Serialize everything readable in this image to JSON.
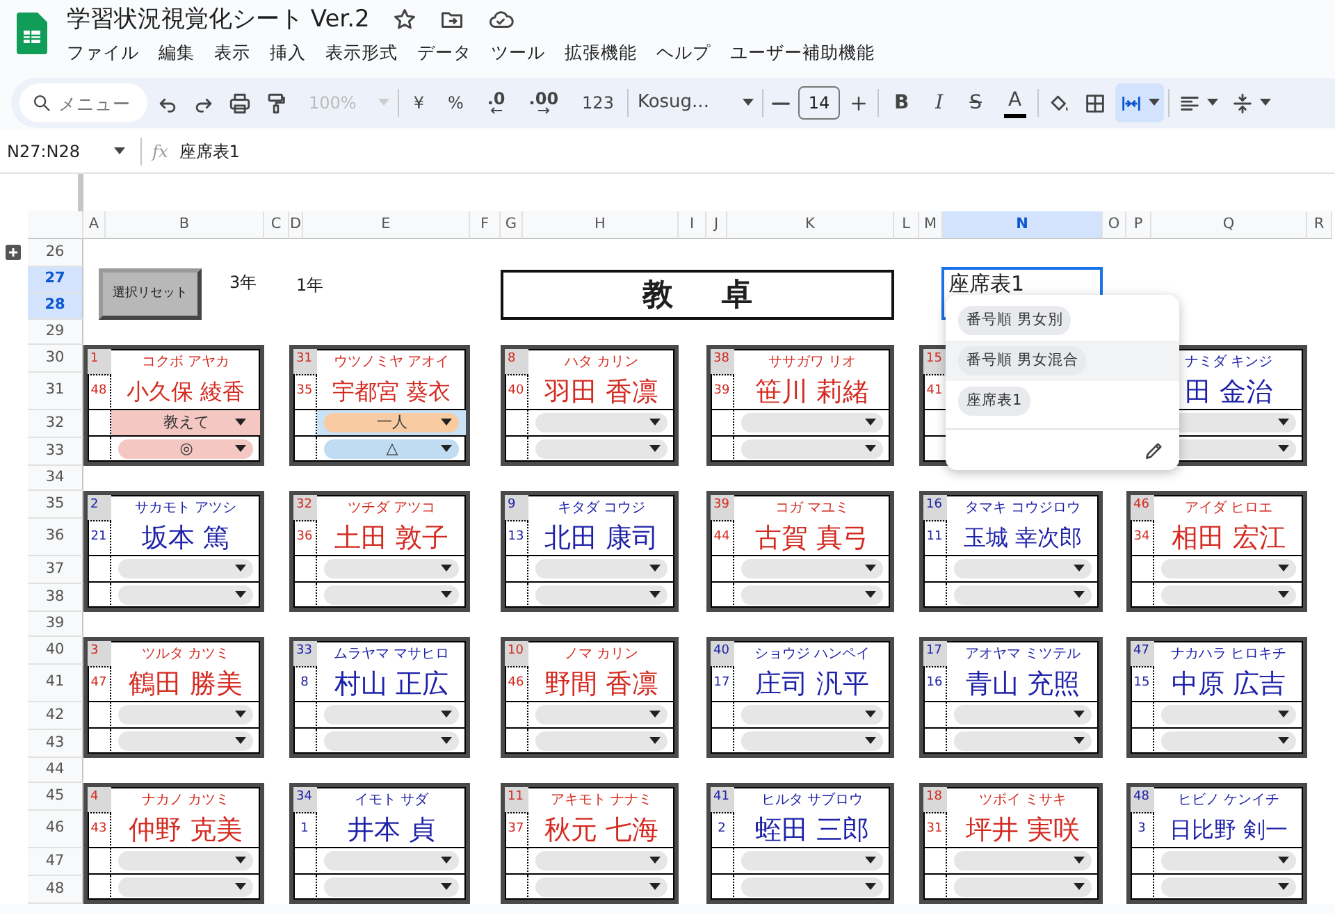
{
  "window": {
    "title": "学習状況視覚化シート Ver.2"
  },
  "menu": [
    "ファイル",
    "編集",
    "表示",
    "挿入",
    "表示形式",
    "データ",
    "ツール",
    "拡張機能",
    "ヘルプ",
    "ユーザー補助機能"
  ],
  "toolbar": {
    "search": {
      "placeholder": "メニュー"
    },
    "zoom": {
      "value": "100%",
      "disabled": true
    },
    "number_formats": [
      {
        "kind": "plain",
        "label": "¥"
      },
      {
        "kind": "plain",
        "label": "%"
      },
      {
        "kind": "decrease",
        "label": ".0"
      },
      {
        "kind": "increase",
        "label": ".00"
      },
      {
        "kind": "plain",
        "label": "123"
      }
    ],
    "font": "Kosug...",
    "font_size": "14",
    "text_styles": [
      {
        "kind": "bold",
        "label": "B"
      },
      {
        "kind": "italic",
        "label": "I"
      },
      {
        "kind": "strikethrough",
        "label": "S"
      },
      {
        "kind": "text_color",
        "label": "A"
      }
    ],
    "merge_selected": true
  },
  "formula_bar": {
    "range": "N27:N28",
    "label": "fx",
    "value": "座席表1"
  },
  "columns": [
    {
      "label": "A",
      "selected": false
    },
    {
      "label": "B",
      "selected": false
    },
    {
      "label": "C",
      "selected": false
    },
    {
      "label": "D",
      "selected": false
    },
    {
      "label": "E",
      "selected": false
    },
    {
      "label": "F",
      "selected": false
    },
    {
      "label": "G",
      "selected": false
    },
    {
      "label": "H",
      "selected": false
    },
    {
      "label": "I",
      "selected": false
    },
    {
      "label": "J",
      "selected": false
    },
    {
      "label": "K",
      "selected": false
    },
    {
      "label": "L",
      "selected": false
    },
    {
      "label": "M",
      "selected": false
    },
    {
      "label": "N",
      "selected": true
    },
    {
      "label": "O",
      "selected": false
    },
    {
      "label": "P",
      "selected": false
    },
    {
      "label": "Q",
      "selected": false
    },
    {
      "label": "R",
      "selected": false
    }
  ],
  "rows": [
    {
      "label": "26",
      "selected": false
    },
    {
      "label": "27",
      "selected": true
    },
    {
      "label": "28",
      "selected": true
    },
    {
      "label": "29",
      "selected": false
    },
    {
      "label": "30",
      "selected": false
    },
    {
      "label": "31",
      "selected": false
    },
    {
      "label": "32",
      "selected": false
    },
    {
      "label": "33",
      "selected": false
    },
    {
      "label": "34",
      "selected": false
    },
    {
      "label": "35",
      "selected": false
    },
    {
      "label": "36",
      "selected": false
    },
    {
      "label": "37",
      "selected": false
    },
    {
      "label": "38",
      "selected": false
    },
    {
      "label": "39",
      "selected": false
    },
    {
      "label": "40",
      "selected": false
    },
    {
      "label": "41",
      "selected": false
    },
    {
      "label": "42",
      "selected": false
    },
    {
      "label": "43",
      "selected": false
    },
    {
      "label": "44",
      "selected": false
    },
    {
      "label": "45",
      "selected": false
    },
    {
      "label": "46",
      "selected": false
    },
    {
      "label": "47",
      "selected": false
    },
    {
      "label": "48",
      "selected": false
    }
  ],
  "sheet": {
    "reset_button": "選択リセット",
    "grade": "3年",
    "class": "1年",
    "teacher_desk": "教卓",
    "selected_cell": "座席表1"
  },
  "cards": [
    {
      "number": "1",
      "index": "48",
      "reading": "コクボ アヤカ",
      "name": "小久保 綾香",
      "color": "#d42a20",
      "chips": [
        {
          "value": "教えて",
          "color": "#f4c7c3",
          "cell": {
            "color": "#f4c7c3"
          }
        },
        {
          "value": "◎",
          "color": "#f4c7c3"
        }
      ]
    },
    {
      "number": "31",
      "index": "35",
      "reading": "ウツノミヤ アオイ",
      "name": "宇都宮 葵衣",
      "color": "#d42a20",
      "chips": [
        {
          "value": "一人",
          "color": "#f9cba3",
          "cell": {
            "color": "#c9e2f5"
          }
        },
        {
          "value": "△",
          "color": "#bfdcf3"
        }
      ]
    },
    {
      "number": "8",
      "index": "40",
      "reading": "ハタ カリン",
      "name": "羽田 香凛",
      "color": "#d42a20",
      "chips": [
        {
          "color": "#e6e6e6"
        },
        {
          "color": "#e6e6e6"
        }
      ]
    },
    {
      "number": "38",
      "index": "39",
      "reading": "ササガワ リオ",
      "name": "笹川 莉緒",
      "color": "#d42a20",
      "chips": [
        {
          "color": "#e6e6e6"
        },
        {
          "color": "#e6e6e6"
        }
      ]
    },
    {
      "number": "15",
      "index": "41",
      "color": "#d42a20"
    },
    {
      "reading": "ナミダ キンジ",
      "name": "田 金治",
      "color": "#1e22a8",
      "chips": [
        {
          "color": "#e6e6e6"
        },
        {
          "color": "#e6e6e6"
        }
      ]
    },
    {
      "number": "2",
      "index": "21",
      "reading": "サカモト アツシ",
      "name": "坂本 篤",
      "color": "#1e22a8",
      "chips": [
        {
          "color": "#e6e6e6"
        },
        {
          "color": "#e6e6e6"
        }
      ]
    },
    {
      "number": "32",
      "index": "36",
      "reading": "ツチダ アツコ",
      "name": "土田 敦子",
      "color": "#d42a20",
      "chips": [
        {
          "color": "#e6e6e6"
        },
        {
          "color": "#e6e6e6"
        }
      ]
    },
    {
      "number": "9",
      "index": "13",
      "reading": "キタダ コウジ",
      "name": "北田 康司",
      "color": "#1e22a8",
      "chips": [
        {
          "color": "#e6e6e6"
        },
        {
          "color": "#e6e6e6"
        }
      ]
    },
    {
      "number": "39",
      "index": "44",
      "reading": "コガ マユミ",
      "name": "古賀 真弓",
      "color": "#d42a20",
      "chips": [
        {
          "color": "#e6e6e6"
        },
        {
          "color": "#e6e6e6"
        }
      ]
    },
    {
      "number": "16",
      "index": "11",
      "reading": "タマキ コウジロウ",
      "name": "玉城 幸次郎",
      "color": "#1e22a8",
      "chips": [
        {
          "color": "#e6e6e6"
        },
        {
          "color": "#e6e6e6"
        }
      ]
    },
    {
      "number": "46",
      "index": "34",
      "reading": "アイダ ヒロエ",
      "name": "相田 宏江",
      "color": "#d42a20",
      "chips": [
        {
          "color": "#e6e6e6"
        },
        {
          "color": "#e6e6e6"
        }
      ]
    },
    {
      "number": "3",
      "index": "47",
      "reading": "ツルタ カツミ",
      "name": "鶴田 勝美",
      "color": "#d42a20",
      "chips": [
        {
          "color": "#e6e6e6"
        },
        {
          "color": "#e6e6e6"
        }
      ]
    },
    {
      "number": "33",
      "index": "8",
      "reading": "ムラヤマ マサヒロ",
      "name": "村山 正広",
      "color": "#1e22a8",
      "chips": [
        {
          "color": "#e6e6e6"
        },
        {
          "color": "#e6e6e6"
        }
      ]
    },
    {
      "number": "10",
      "index": "46",
      "reading": "ノマ カリン",
      "name": "野間 香凛",
      "color": "#d42a20",
      "chips": [
        {
          "color": "#e6e6e6"
        },
        {
          "color": "#e6e6e6"
        }
      ]
    },
    {
      "number": "40",
      "index": "17",
      "reading": "ショウジ ハンペイ",
      "name": "庄司 汎平",
      "color": "#1e22a8",
      "chips": [
        {
          "color": "#e6e6e6"
        },
        {
          "color": "#e6e6e6"
        }
      ]
    },
    {
      "number": "17",
      "index": "16",
      "reading": "アオヤマ ミツテル",
      "name": "青山 充照",
      "color": "#1e22a8",
      "chips": [
        {
          "color": "#e6e6e6"
        },
        {
          "color": "#e6e6e6"
        }
      ]
    },
    {
      "number": "47",
      "index": "15",
      "reading": "ナカハラ ヒロキチ",
      "name": "中原 広吉",
      "color": "#1e22a8",
      "chips": [
        {
          "color": "#e6e6e6"
        },
        {
          "color": "#e6e6e6"
        }
      ]
    },
    {
      "number": "4",
      "index": "43",
      "reading": "ナカノ カツミ",
      "name": "仲野 克美",
      "color": "#d42a20",
      "chips": [
        {
          "color": "#e6e6e6"
        },
        {
          "color": "#e6e6e6"
        }
      ]
    },
    {
      "number": "34",
      "index": "1",
      "reading": "イモト サダ",
      "name": "井本 貞",
      "color": "#1e22a8",
      "chips": [
        {
          "color": "#e6e6e6"
        },
        {
          "color": "#e6e6e6"
        }
      ]
    },
    {
      "number": "11",
      "index": "37",
      "reading": "アキモト ナナミ",
      "name": "秋元 七海",
      "color": "#d42a20",
      "chips": [
        {
          "color": "#e6e6e6"
        },
        {
          "color": "#e6e6e6"
        }
      ]
    },
    {
      "number": "41",
      "index": "2",
      "reading": "ヒルタ サブロウ",
      "name": "蛭田 三郎",
      "color": "#1e22a8",
      "chips": [
        {
          "color": "#e6e6e6"
        },
        {
          "color": "#e6e6e6"
        }
      ]
    },
    {
      "number": "18",
      "index": "31",
      "reading": "ツボイ ミサキ",
      "name": "坪井 実咲",
      "color": "#d42a20",
      "chips": [
        {
          "color": "#e6e6e6"
        },
        {
          "color": "#e6e6e6"
        }
      ]
    },
    {
      "number": "48",
      "index": "3",
      "reading": "ヒビノ ケンイチ",
      "name": "日比野 剣一",
      "color": "#1e22a8",
      "chips": [
        {
          "color": "#e6e6e6"
        },
        {
          "color": "#e6e6e6"
        }
      ]
    }
  ],
  "dropdown_menu": {
    "options": [
      {
        "label": "番号順 男女別",
        "highlighted": false
      },
      {
        "label": "番号順 男女混合",
        "highlighted": true
      },
      {
        "label": "座席表1",
        "highlighted": false
      }
    ]
  }
}
